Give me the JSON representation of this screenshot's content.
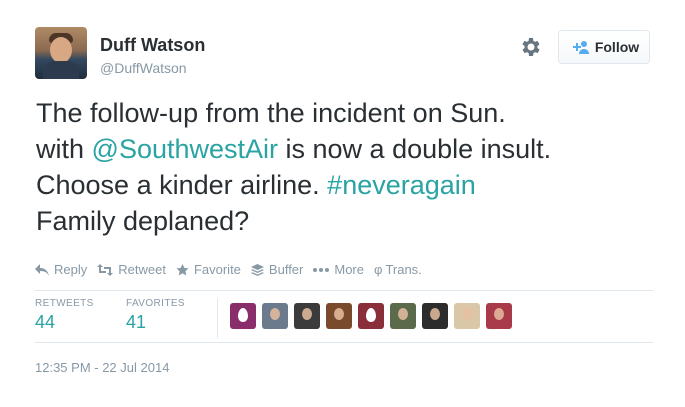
{
  "author": {
    "name": "Duff Watson",
    "handle": "@DuffWatson",
    "avatar_icon": "profile-photo"
  },
  "header": {
    "follow_label": "Follow",
    "settings_icon": "gear-icon"
  },
  "tweet": {
    "line1": "The follow-up from the incident on Sun.",
    "line2_prefix": "with ",
    "mention": "@SouthwestAir",
    "line2_suffix": " is now a double insult.",
    "line3_prefix": "Choose a kinder airline. ",
    "hashtag": "#neveragain",
    "line4": "Family deplaned?"
  },
  "actions": [
    {
      "label": "Reply",
      "icon": "reply-icon"
    },
    {
      "label": "Retweet",
      "icon": "retweet-icon"
    },
    {
      "label": "Favorite",
      "icon": "star-icon"
    },
    {
      "label": "Buffer",
      "icon": "buffer-icon"
    },
    {
      "label": "More",
      "icon": "more-icon"
    },
    {
      "label": "Trans.",
      "icon": "translate-icon"
    }
  ],
  "stats": {
    "retweets_label": "RETWEETS",
    "retweets_value": "44",
    "favorites_label": "FAVORITES",
    "favorites_value": "41"
  },
  "favoriters": [
    {
      "type": "egg",
      "color": "#8a2e6b"
    },
    {
      "type": "photo",
      "color": "#6b7a8c"
    },
    {
      "type": "photo",
      "color": "#3b3b3b"
    },
    {
      "type": "photo",
      "color": "#7a4a2c"
    },
    {
      "type": "egg",
      "color": "#8a2e3a"
    },
    {
      "type": "photo",
      "color": "#5a6a4a"
    },
    {
      "type": "photo",
      "color": "#2c2c2c"
    },
    {
      "type": "photo",
      "color": "#d9c7a8"
    },
    {
      "type": "photo",
      "color": "#a83a4a"
    }
  ],
  "timestamp": "12:35 PM - 22 Jul 2014",
  "colors": {
    "accent": "#2aa3a3",
    "muted": "#8899a6",
    "text": "#292f33"
  }
}
